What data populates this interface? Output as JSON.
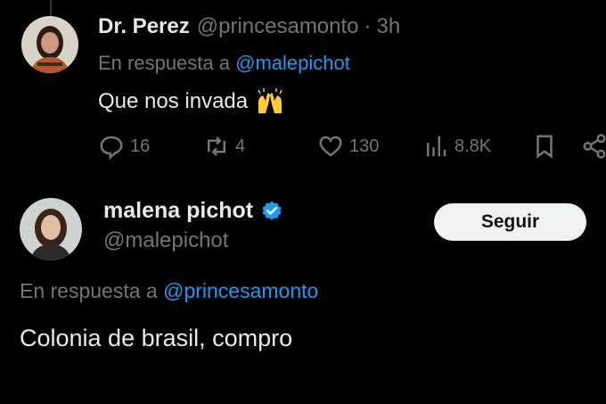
{
  "reply_tweet": {
    "display_name": "Dr. Perez",
    "handle": "@princesamonto",
    "separator": "·",
    "time": "3h",
    "replying_prefix": "En respuesta a",
    "replying_to": "@malepichot",
    "text": "Que nos invada",
    "emoji": "raising-hands-icon",
    "actions": {
      "replies": "16",
      "reposts": "4",
      "likes": "130",
      "views": "8.8K"
    }
  },
  "main_tweet": {
    "display_name": "malena pichot",
    "handle": "@malepichot",
    "verified": true,
    "follow_label": "Seguir",
    "replying_prefix": "En respuesta a",
    "replying_to": "@princesamonto",
    "text": "Colonia de brasil, compro"
  },
  "colors": {
    "background": "#000000",
    "text": "#e7e9ea",
    "muted": "#71767b",
    "accent": "#1d9bf0",
    "button_bg": "#eff3f4",
    "button_text": "#0f1419"
  }
}
